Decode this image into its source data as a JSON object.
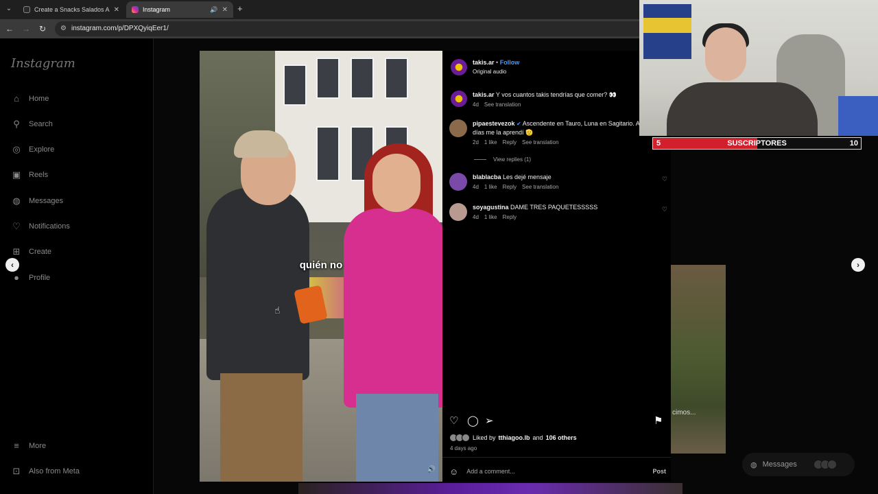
{
  "browser": {
    "tabs": [
      {
        "title": "Create a Snacks Salados Argen",
        "favicon_color": "#2a2a2a",
        "active": false
      },
      {
        "title": "Instagram",
        "favicon_color": "#d6249f",
        "active": true
      }
    ],
    "url": "instagram.com/p/DPXQyiqEer1/"
  },
  "sidebar": {
    "logo": "Instagram",
    "items": [
      {
        "label": "Home",
        "icon": "home-icon",
        "glyph": "⌂"
      },
      {
        "label": "Search",
        "icon": "search-icon",
        "glyph": "⚲"
      },
      {
        "label": "Explore",
        "icon": "explore-icon",
        "glyph": "◎"
      },
      {
        "label": "Reels",
        "icon": "reels-icon",
        "glyph": "▣"
      },
      {
        "label": "Messages",
        "icon": "messages-icon",
        "glyph": "◍"
      },
      {
        "label": "Notifications",
        "icon": "heart-icon",
        "glyph": "♡"
      },
      {
        "label": "Create",
        "icon": "plus-square-icon",
        "glyph": "⊞"
      },
      {
        "label": "Profile",
        "icon": "avatar-icon",
        "glyph": "●"
      }
    ],
    "bottom": [
      {
        "label": "More",
        "icon": "menu-icon",
        "glyph": "≡"
      },
      {
        "label": "Also from Meta",
        "icon": "meta-icon",
        "glyph": "⊡"
      }
    ]
  },
  "video": {
    "subtitle": "quién no"
  },
  "post": {
    "author": "takis.ar",
    "follow": "Follow",
    "audio": "Original audio",
    "caption": {
      "user": "takis.ar",
      "text": "Y vos cuantos takis tendrías que comer? 👀",
      "time": "4d",
      "translate": "See translation"
    },
    "comments": [
      {
        "user": "pipaestevezok",
        "verified": true,
        "text": "Ascendente en Tauro, Luna en Sagitario. A los 10 días me la aprendí 🫡",
        "time": "2d",
        "likes": "1 like",
        "reply": "Reply",
        "translate": "See translation",
        "avatar_color": "#8a6a4a"
      },
      {
        "user": "blablacba",
        "verified": false,
        "text": "Les dejé mensaje",
        "time": "4d",
        "likes": "1 like",
        "reply": "Reply",
        "translate": "See translation",
        "avatar_color": "#7a4aa8"
      },
      {
        "user": "soyagustina",
        "verified": false,
        "text": "DAME TRES PAQUETESSSSS",
        "time": "4d",
        "likes": "1 like",
        "reply": "Reply",
        "translate": "",
        "avatar_color": "#b89a90"
      }
    ],
    "view_replies": "View replies (1)",
    "liked_by_prefix": "Liked by",
    "liked_by_user": "tthiagoo.lb",
    "liked_by_and": "and",
    "liked_by_others": "106 others",
    "time_ago": "4 days ago",
    "add_comment_placeholder": "Add a comment...",
    "post_button": "Post"
  },
  "background": {
    "thumb_text": "cimos..."
  },
  "messages_pill": {
    "label": "Messages"
  },
  "stream": {
    "sub_goal": {
      "current": "5",
      "label": "SUSCRIPTORES",
      "goal": "10",
      "progress": 0.5
    }
  }
}
